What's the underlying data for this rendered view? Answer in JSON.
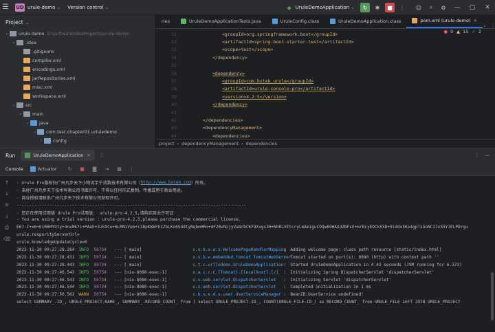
{
  "titlebar": {
    "project_badge": "UD",
    "project_name": "urule-demo",
    "vcs_label": "Version control",
    "run_config": "UruleDemoApplication"
  },
  "project_panel": {
    "title": "Project",
    "tree": [
      {
        "name": "urule-demo",
        "path": "D:\\software\\IdeaProjects\\urule-demo",
        "indent": 0,
        "arrow": "v",
        "icon": "folder"
      },
      {
        "name": ".idea",
        "path": "",
        "indent": 1,
        "arrow": "v",
        "icon": "folder"
      },
      {
        "name": ".gitignore",
        "path": "",
        "indent": 2,
        "arrow": "",
        "icon": "file-git"
      },
      {
        "name": "compiler.xml",
        "path": "",
        "indent": 2,
        "arrow": "",
        "icon": "file-xml"
      },
      {
        "name": "encodings.xml",
        "path": "",
        "indent": 2,
        "arrow": "",
        "icon": "file-xml"
      },
      {
        "name": "jarRepositories.xml",
        "path": "",
        "indent": 2,
        "arrow": "",
        "icon": "file-xml"
      },
      {
        "name": "misc.xml",
        "path": "",
        "indent": 2,
        "arrow": "",
        "icon": "file-xml"
      },
      {
        "name": "workspace.xml",
        "path": "",
        "indent": 2,
        "arrow": "",
        "icon": "file-xml"
      },
      {
        "name": "src",
        "path": "",
        "indent": 1,
        "arrow": "v",
        "icon": "folder"
      },
      {
        "name": "main",
        "path": "",
        "indent": 2,
        "arrow": "v",
        "icon": "folder"
      },
      {
        "name": "java",
        "path": "",
        "indent": 3,
        "arrow": "v",
        "icon": "folder-blue"
      },
      {
        "name": "com.test.chapter01.urluledemo",
        "path": "",
        "indent": 4,
        "arrow": "v",
        "icon": "pkg"
      },
      {
        "name": "config",
        "path": "",
        "indent": 5,
        "arrow": ">",
        "icon": "pkg"
      }
    ]
  },
  "editor": {
    "tabs": [
      {
        "label": "ries",
        "active": false,
        "icon_color": ""
      },
      {
        "label": "UruleDemoApplicationTests.java",
        "active": false,
        "icon_color": "#5fb865"
      },
      {
        "label": "UruleConfig.class",
        "active": false,
        "icon_color": "#5b9bd5"
      },
      {
        "label": "UruleDemoApplication.class",
        "active": false,
        "icon_color": "#5b9bd5"
      },
      {
        "label": "pom.xml (urule-demo)",
        "active": true,
        "icon_color": "#e8a85b"
      }
    ],
    "problems": {
      "errors": "9",
      "warnings": "15",
      "ok": "2"
    },
    "lines": [
      {
        "n": "31",
        "indent": 4,
        "html": "<groupId>org.springframework.boot</groupId>"
      },
      {
        "n": "32",
        "indent": 4,
        "html": "<artifactId>spring-boot-starter-test</artifactId>"
      },
      {
        "n": "33",
        "indent": 4,
        "html": "<scope>test</scope>"
      },
      {
        "n": "34",
        "indent": 3,
        "html": "</dependency>"
      },
      {
        "n": "35",
        "indent": 0,
        "html": ""
      },
      {
        "n": "36",
        "indent": 3,
        "html": "<dependency>"
      },
      {
        "n": "37",
        "indent": 4,
        "html": "<groupId>com.bstek.urule</groupId>"
      },
      {
        "n": "38",
        "indent": 4,
        "html": "<artifactId>urule-console-pro</artifactId>"
      },
      {
        "n": "39",
        "indent": 4,
        "html": "<version>4.2.5</version>"
      },
      {
        "n": "40",
        "indent": 3,
        "html": "</dependency>"
      },
      {
        "n": "41",
        "indent": 0,
        "html": ""
      },
      {
        "n": "42",
        "indent": 2,
        "html": "</dependencies>"
      },
      {
        "n": "43",
        "indent": 2,
        "html": "<dependencyManagement>"
      },
      {
        "n": "44",
        "indent": 3,
        "html": "<dependencies>"
      }
    ],
    "breadcrumb": [
      "project",
      "dependencyManagement",
      "dependencies"
    ]
  },
  "run_panel": {
    "title": "Run",
    "run_tab": "UruleDemoApplication",
    "toolbar": {
      "console": "Console",
      "actuator": "Actuator"
    },
    "console_lines": [
      {
        "type": "plain",
        "text": "· Urule Pro版权归广州凡步天下小物流宇宁流数技术有限公司（",
        "link": "http://www.bstek.com",
        "tail": "）所有。"
      },
      {
        "type": "plain",
        "text": "· 未经广州凡步天下技术有限公司书面许可，不得以任何形式复制、传播或用于商业用途。",
        "link": "",
        "tail": ""
      },
      {
        "type": "plain",
        "text": "· 商业授权请联系广州凡步天下技术有限公司获取许可。",
        "link": "",
        "tail": ""
      },
      {
        "type": "plain",
        "text": "-------------------------------------------------------------------------------------------",
        "link": "",
        "tail": ""
      },
      {
        "type": "plain",
        "text": "· 您正在使用试用版 Urule Pro试用版： urule-pro-4.2.5,请购买商业许可证",
        "link": "",
        "tail": ""
      },
      {
        "type": "plain",
        "text": "· You are using a trial version : urule-pro-4.2.5,please purchase the commercial license.",
        "link": "",
        "tail": ""
      },
      {
        "type": "plain",
        "text": "E67-I+x6+E1R6MY9ty+4nxMk7i+PAeh+3zk9Cu+6LMNzVeb+c1BpKWkFE1ZbLKo6SddtyNqbmHRn+dF2BvNzjyVaNrbCKF9Xvgs3H+NhRLVEtcryLmAmiguCOQw69HAXdZBFsE+mrELyEOCkS5D+9iddx5Ke4gpTsGoNCIJxS5YJELPDrgu",
        "link": "",
        "tail": ""
      },
      {
        "type": "plain",
        "text": "urule.resporityServerUrl=",
        "link": "",
        "tail": ""
      },
      {
        "type": "plain",
        "text": "urule.knowledgeUpdateCycle=0",
        "link": "",
        "tail": ""
      },
      {
        "type": "log",
        "ts": "2023-11-30 09:27:28.284",
        "lvl": "INFO",
        "pid": "59734",
        "thread": "[           main]",
        "logger": "o.s.b.a.w.s.WelcomePageHandlerMapping",
        "msg": "Adding welcome page: class path resource [static/index.html]"
      },
      {
        "type": "log",
        "ts": "2023-11-30 09:27:28.431",
        "lvl": "INFO",
        "pid": "59734",
        "thread": "[           main]",
        "logger": "o.s.b.w.embedded.tomcat.TomcatWebServer",
        "msg": "Tomcat started on port(s): 8080 (http) with context path ''"
      },
      {
        "type": "log",
        "ts": "2023-11-30 09:27:28.443",
        "lvl": "INFO",
        "pid": "59734",
        "thread": "[           main]",
        "logger": "c.t.c.urlledemo.UruleDemoApplication",
        "msg": "Started UruleDemoApplication in 4.43 seconds (JVM running for 6.373)"
      },
      {
        "type": "log",
        "ts": "2023-11-30 09:27:46.543",
        "lvl": "INFO",
        "pid": "59734",
        "thread": "[nio-8080-exec-1]",
        "logger": "o.a.c.c.C.[Tomcat].[localhost].[/]",
        "msg": "Initializing Spring DispatcherServlet 'dispatcherServlet'"
      },
      {
        "type": "log",
        "ts": "2023-11-30 09:27:46.543",
        "lvl": "INFO",
        "pid": "59734",
        "thread": "[nio-8080-exec-1]",
        "logger": "o.s.web.servlet.DispatcherServlet",
        "msg": "Initializing Servlet 'dispatcherServlet'"
      },
      {
        "type": "log",
        "ts": "2023-11-30 09:27:46.544",
        "lvl": "INFO",
        "pid": "59734",
        "thread": "[nio-8080-exec-1]",
        "logger": "o.s.web.servlet.DispatcherServlet",
        "msg": "Completed initialization in 1 ms"
      },
      {
        "type": "log",
        "ts": "2023-11-30 09:27:50.562",
        "lvl": "WARN",
        "pid": "59734",
        "thread": "[nio-8080-exec-1]",
        "logger": "c.b.u.e.d.s.user.UserServiceManager",
        "msg": "BeanID:UserService undefined!"
      },
      {
        "type": "plain",
        "text": "select SUMMARY_.ID_, URULE_PROJECT.NAME_, SUMMARY_.RECORD_COUNT_ from ( select URULE_PROJECT.ID_, COUNT(URULE_FILE.ID_) as RECORD_COUNT_ from URULE_FILE LEFT JOIN URULE_PROJECT",
        "link": "",
        "tail": ""
      }
    ]
  },
  "colors": {
    "accent": "#3574f0",
    "run_green": "#57965c",
    "stop_red": "#c94f4f",
    "info_green": "#5fb865",
    "warn_orange": "#d9a343",
    "logger_blue": "#56a8f5",
    "pid_purple": "#c77dbb",
    "xml_tag": "#d5b778"
  }
}
